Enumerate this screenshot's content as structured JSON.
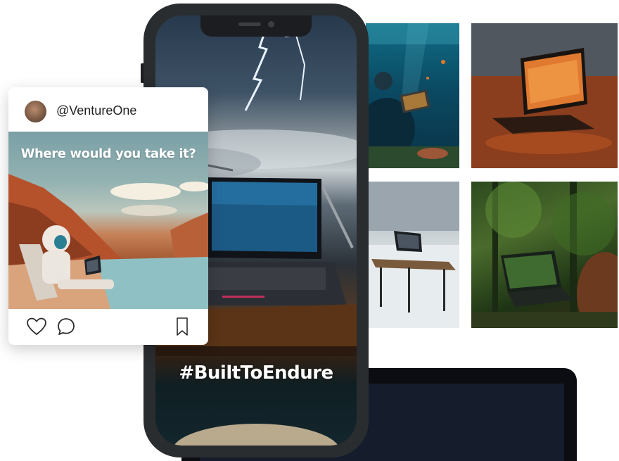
{
  "social_post": {
    "username": "@VentureOne",
    "caption": "Where would you take it?",
    "icons": [
      "avatar",
      "heart-icon",
      "comment-icon",
      "bookmark-icon"
    ]
  },
  "phone": {
    "hashtag": "#BuiltToEndure"
  },
  "gallery": [
    "underwater-laptop",
    "lava-laptop",
    "ice-desk-laptop",
    "jungle-laptop"
  ],
  "colors": {
    "phone_frame": "#2a2d30",
    "card_background": "#ffffff",
    "text_primary": "#1f1f1f"
  }
}
